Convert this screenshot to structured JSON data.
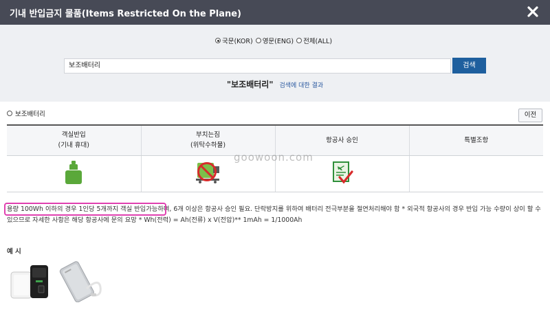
{
  "header": {
    "title": "기내 반입금지 물품(Items Restricted On the Plane)",
    "close_icon": "close-icon"
  },
  "search": {
    "language_options": [
      {
        "label": "국문(KOR)",
        "selected": true
      },
      {
        "label": "영문(ENG)",
        "selected": false
      },
      {
        "label": "전체(ALL)",
        "selected": false
      }
    ],
    "query": "보조배터리",
    "button_label": "검색",
    "result_term": "\"보조배터리\"",
    "result_suffix": "검색에 대한 결과"
  },
  "result": {
    "category_label": "보조배터리",
    "prev_button": "이전",
    "columns": [
      {
        "line1": "객실반입",
        "line2": "(기내 휴대)"
      },
      {
        "line1": "부치는짐",
        "line2": "(위탁수하물)"
      },
      {
        "line1": "항공사 승인",
        "line2": ""
      },
      {
        "line1": "특별조항",
        "line2": ""
      }
    ],
    "icons": [
      "carry-on-allowed-icon",
      "checked-baggage-prohibited-icon",
      "airline-approval-icon"
    ],
    "colors": {
      "allowed": "#5aa83a",
      "prohibited": "#d72b2b",
      "approval": "#2f8f3a"
    },
    "description_highlight": "용량 100Wh 이하의 경우 1인당 5개까지 객실 반입가능",
    "description_rest": "하며, 6개 이상은 항공사 승인 필요. 단락방지를 위하여 배터리 전극부분을 절연처리해야 함 * 외국적 항공사의 경우 반입 가능 수량이 상이 할 수 있으므로 자세한 사항은 해당 항공사에 문의 요망 * Wh(전력) = Ah(전류) x V(전압)** 1mAh = 1/1000Ah"
  },
  "examples": {
    "label": "예 시",
    "images": [
      "power-bank-pair-image",
      "slim-power-bank-with-cable-image"
    ]
  },
  "watermark": "goowoon.com"
}
